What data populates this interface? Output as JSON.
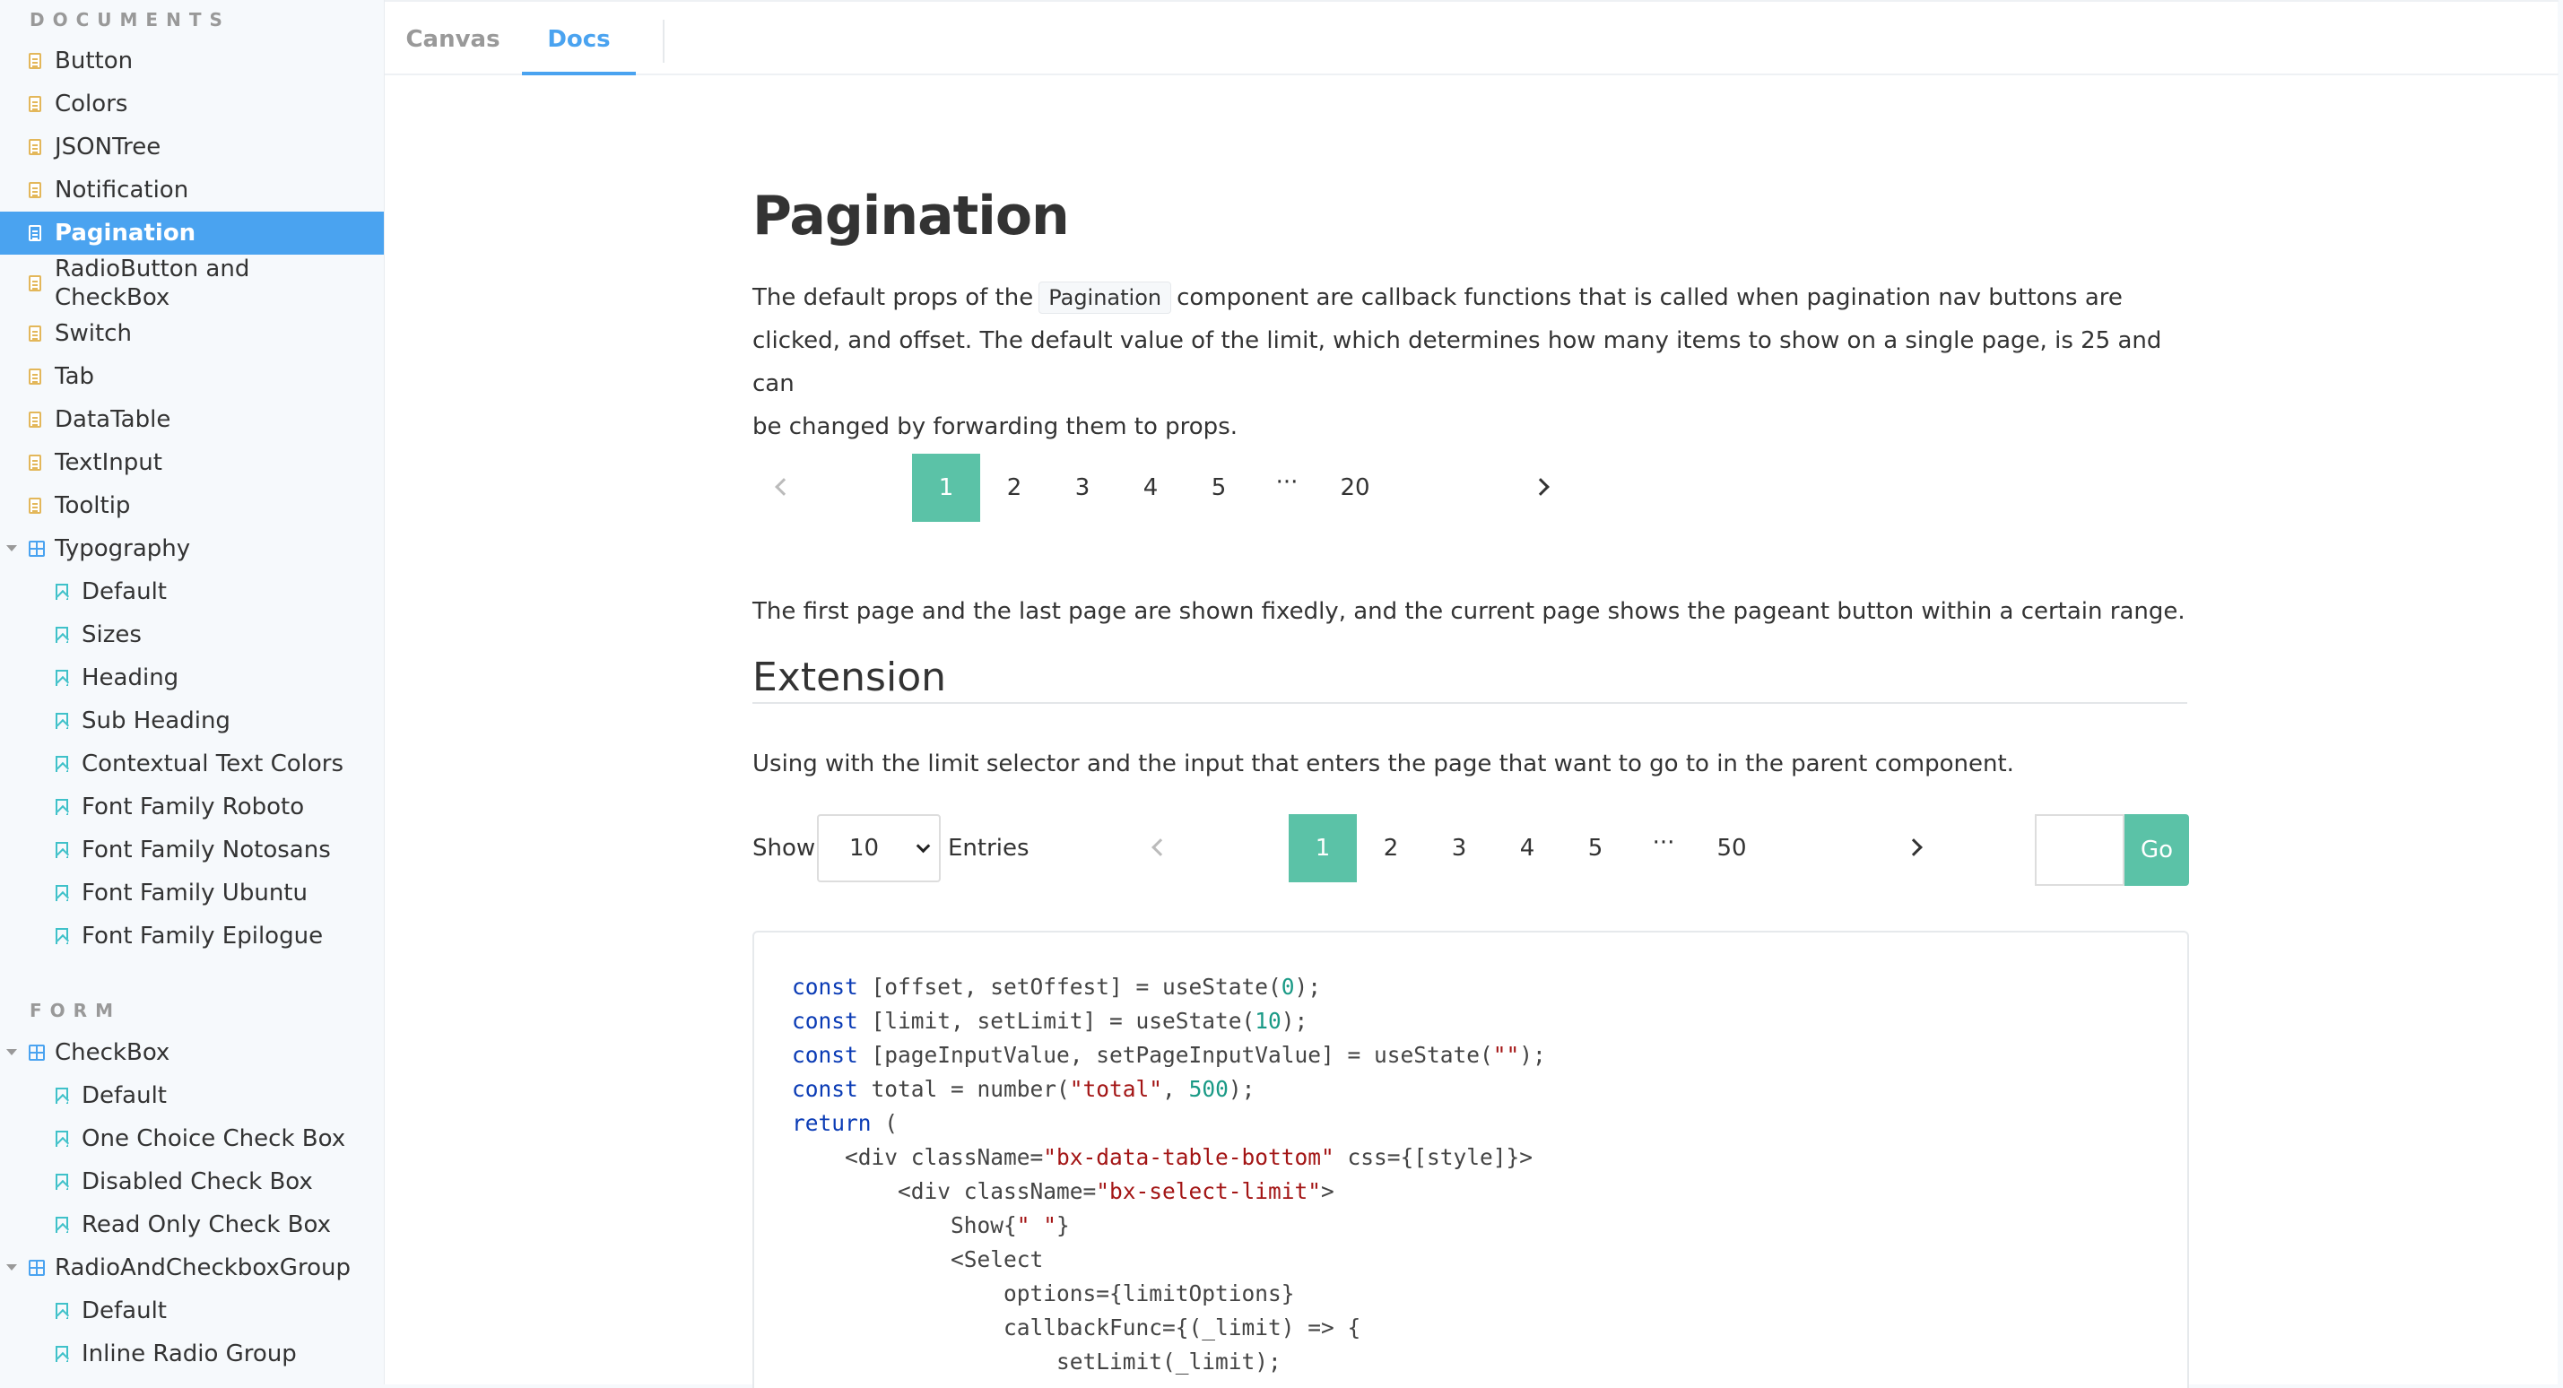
{
  "sidebar": {
    "documents_title": "DOCUMENTS",
    "documents": [
      {
        "label": "Button"
      },
      {
        "label": "Colors"
      },
      {
        "label": "JSONTree"
      },
      {
        "label": "Notification"
      },
      {
        "label": "Pagination",
        "active": true
      },
      {
        "label": "RadioButton and",
        "label2": "CheckBox"
      },
      {
        "label": "Switch"
      },
      {
        "label": "Tab"
      },
      {
        "label": "DataTable"
      },
      {
        "label": "TextInput"
      },
      {
        "label": "Tooltip"
      }
    ],
    "typography": {
      "label": "Typography",
      "children": [
        "Default",
        "Sizes",
        "Heading",
        "Sub Heading",
        "Contextual Text Colors",
        "Font Family Roboto",
        "Font Family Notosans",
        "Font Family Ubuntu",
        "Font Family Epilogue"
      ]
    },
    "form_title": "FORM",
    "checkbox": {
      "label": "CheckBox",
      "children": [
        "Default",
        "One Choice Check Box",
        "Disabled Check Box",
        "Read Only Check Box"
      ]
    },
    "radiogroup": {
      "label": "RadioAndCheckboxGroup",
      "children": [
        "Default",
        "Inline Radio Group"
      ]
    }
  },
  "tabs": [
    "Canvas",
    "Docs"
  ],
  "active_tab": "Docs",
  "doc": {
    "title": "Pagination",
    "intro_before": "The default props of the",
    "intro_code": "Pagination",
    "intro_after_line1": "component are callback functions that is called when pagination nav buttons are",
    "intro_line2": "clicked, and offset. The default value of the limit, which determines how many items to show on a single page, is 25 and can",
    "intro_line3": "be changed by forwarding them to props.",
    "pager1": {
      "pages": [
        "1",
        "2",
        "3",
        "4",
        "5",
        "···",
        "20"
      ],
      "current": "1"
    },
    "fixed_text": "The first page and the last page are shown fixedly, and the current page shows the pageant button within a certain range.",
    "extension_title": "Extension",
    "extension_text": "Using with the limit selector and the input that enters the page that want to go to in the parent component.",
    "show_label": "Show",
    "limit_value": "10",
    "entries_label": "Entries",
    "pager2": {
      "pages": [
        "1",
        "2",
        "3",
        "4",
        "5",
        "···",
        "50"
      ],
      "current": "1"
    },
    "go_label": "Go",
    "page_input_value": ""
  },
  "code_lines": [
    [
      [
        "kw",
        "const"
      ],
      [
        "t",
        " [offset, setOffest] = useState("
      ],
      [
        "num",
        "0"
      ],
      [
        "t",
        ");"
      ]
    ],
    [
      [
        "kw",
        "const"
      ],
      [
        "t",
        " [limit, setLimit] = useState("
      ],
      [
        "num",
        "10"
      ],
      [
        "t",
        ");"
      ]
    ],
    [
      [
        "kw",
        "const"
      ],
      [
        "t",
        " [pageInputValue, setPageInputValue] = useState("
      ],
      [
        "str",
        "\"\""
      ],
      [
        "t",
        ");"
      ]
    ],
    [
      [
        "kw",
        "const"
      ],
      [
        "t",
        " total = number("
      ],
      [
        "str",
        "\"total\""
      ],
      [
        "t",
        ", "
      ],
      [
        "num",
        "500"
      ],
      [
        "t",
        ");"
      ]
    ],
    [
      [
        "kw",
        "return"
      ],
      [
        "t",
        " ("
      ]
    ],
    [
      [
        "t",
        "    <div className="
      ],
      [
        "str",
        "\"bx-data-table-bottom\""
      ],
      [
        "t",
        " css={[style]}>"
      ]
    ],
    [
      [
        "t",
        "        <div className="
      ],
      [
        "str",
        "\"bx-select-limit\""
      ],
      [
        "t",
        ">"
      ]
    ],
    [
      [
        "t",
        "            Show{"
      ],
      [
        "str",
        "\" \""
      ],
      [
        "t",
        "}"
      ]
    ],
    [
      [
        "t",
        "            <Select"
      ]
    ],
    [
      [
        "t",
        "                options={limitOptions}"
      ]
    ],
    [
      [
        "t",
        "                callbackFunc={(_limit) => {"
      ]
    ],
    [
      [
        "t",
        "                    setLimit(_limit);"
      ]
    ]
  ]
}
